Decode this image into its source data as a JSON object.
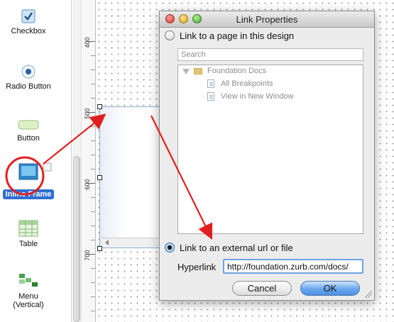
{
  "palette": {
    "items": [
      {
        "label": "Checkbox",
        "icon": "checkbox-icon"
      },
      {
        "label": "Radio Button",
        "icon": "radio-button-icon"
      },
      {
        "label": "Button",
        "icon": "button-icon"
      },
      {
        "label": "Inline Frame",
        "icon": "inline-frame-icon"
      },
      {
        "label": "Table",
        "icon": "table-icon"
      },
      {
        "label": "Menu\n(Vertical)",
        "icon": "menu-vertical-icon"
      }
    ]
  },
  "ruler": {
    "labels": [
      "400",
      "500",
      "600",
      "700"
    ]
  },
  "dialog": {
    "title": "Link Properties",
    "option_page": "Link to a page in this design",
    "search_placeholder": "Search",
    "tree": {
      "root": "Foundation Docs",
      "children": [
        "All Breakpoints",
        "View in New Window"
      ]
    },
    "option_external": "Link to an external url or file",
    "hyperlink_label": "Hyperlink",
    "hyperlink_value": "http://foundation.zurb.com/docs/",
    "cancel": "Cancel",
    "ok": "OK"
  },
  "colors": {
    "annotation": "#e02020",
    "selection": "#2f6fd1",
    "accent": "#6ea2e0"
  }
}
